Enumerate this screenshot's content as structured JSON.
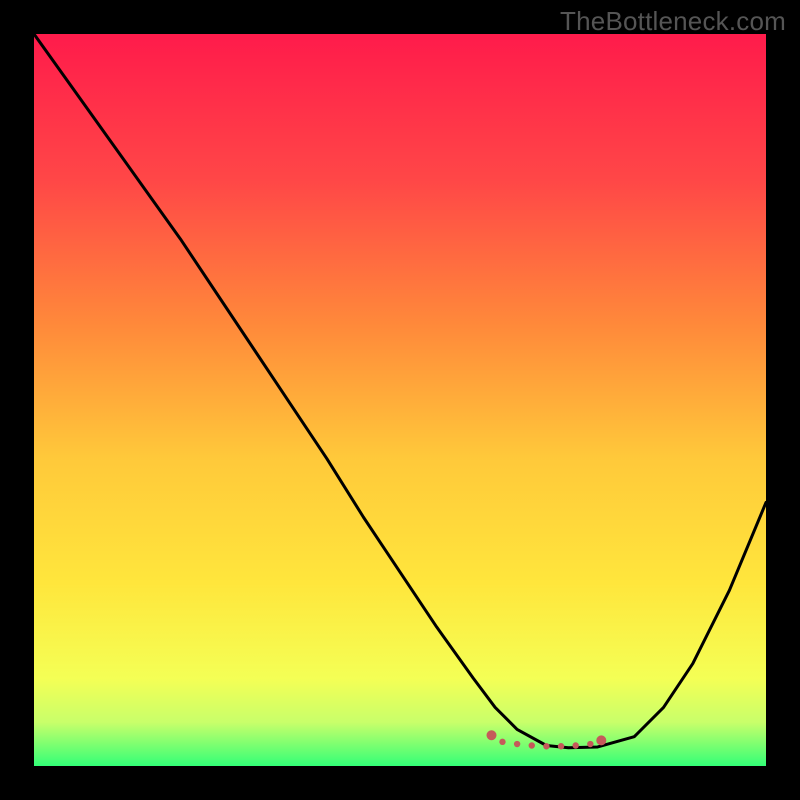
{
  "watermark": "TheBottleneck.com",
  "chart_data": {
    "type": "line",
    "title": "",
    "xlabel": "",
    "ylabel": "",
    "xlim": [
      0,
      100
    ],
    "ylim": [
      0,
      100
    ],
    "grid": false,
    "gradient_stops": [
      {
        "offset": 0,
        "color": "#ff1b4b"
      },
      {
        "offset": 20,
        "color": "#ff4747"
      },
      {
        "offset": 40,
        "color": "#ff8a3a"
      },
      {
        "offset": 58,
        "color": "#ffc93a"
      },
      {
        "offset": 75,
        "color": "#ffe63c"
      },
      {
        "offset": 88,
        "color": "#f4ff55"
      },
      {
        "offset": 94,
        "color": "#c9ff6a"
      },
      {
        "offset": 100,
        "color": "#33ff77"
      }
    ],
    "series": [
      {
        "name": "bottleneck-curve",
        "color": "#000000",
        "x": [
          0,
          5,
          10,
          15,
          20,
          25,
          30,
          35,
          40,
          45,
          50,
          55,
          60,
          63,
          66,
          70,
          73,
          77,
          82,
          86,
          90,
          95,
          100
        ],
        "y": [
          100,
          93,
          86,
          79,
          72,
          64.5,
          57,
          49.5,
          42,
          34,
          26.5,
          19,
          12,
          8,
          5,
          2.8,
          2.5,
          2.6,
          4,
          8,
          14,
          24,
          36
        ]
      },
      {
        "name": "optimal-segment",
        "color": "#c55a5a",
        "x": [
          62.5,
          64,
          66,
          68,
          70,
          72,
          74,
          76,
          77.5
        ],
        "y": [
          4.2,
          3.3,
          3.0,
          2.8,
          2.7,
          2.7,
          2.8,
          3.0,
          3.5
        ]
      }
    ]
  }
}
